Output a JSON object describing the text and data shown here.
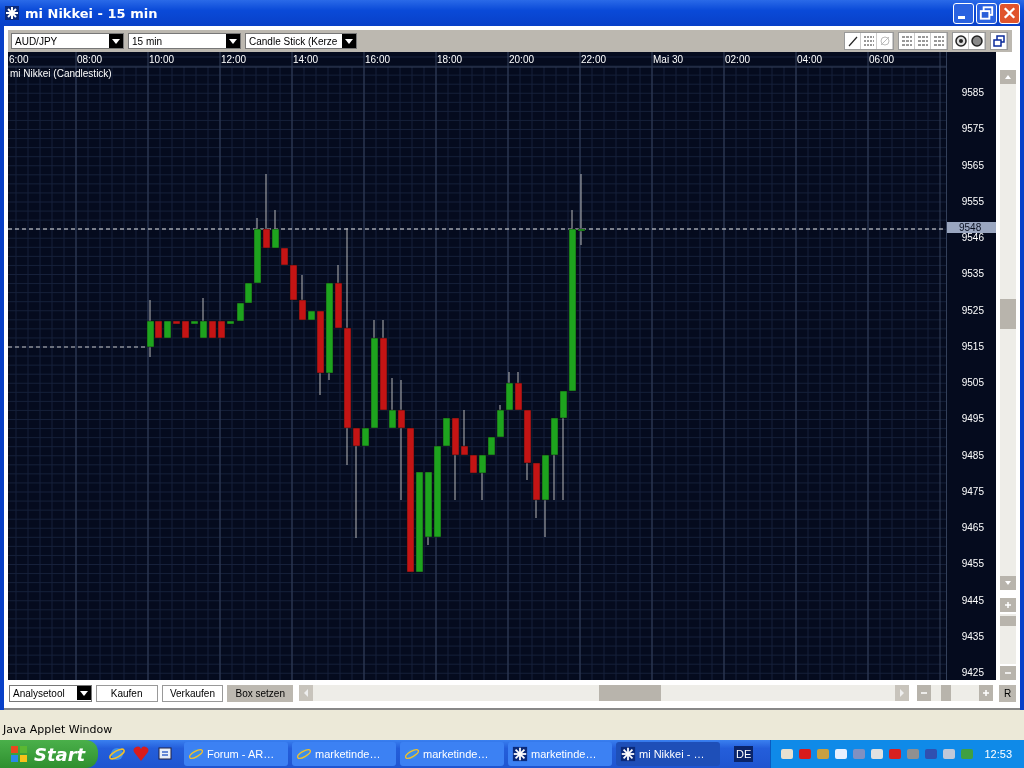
{
  "window": {
    "title": "mi Nikkei - 15 min"
  },
  "toolbar": {
    "dropdowns": [
      {
        "value": "AUD/JPY"
      },
      {
        "value": "15 min"
      },
      {
        "value": "Candle Stick (Kerze"
      }
    ]
  },
  "chart": {
    "title": "mi Nikkei (Candlestick)",
    "x_labels": [
      "6:00",
      "08:00",
      "10:00",
      "12:00",
      "14:00",
      "16:00",
      "18:00",
      "20:00",
      "22:00",
      "Mai 30",
      "02:00",
      "04:00",
      "06:00"
    ],
    "y_labels": [
      "9585",
      "9575",
      "9565",
      "9555",
      "9546",
      "9535",
      "9525",
      "9515",
      "9505",
      "9495",
      "9485",
      "9475",
      "9465",
      "9455",
      "9445",
      "9435",
      "9425"
    ],
    "current_price": "9548"
  },
  "bottom_bar": {
    "tool_dropdown": "Analysetool",
    "buttons": [
      {
        "label": "Kaufen",
        "selected": false
      },
      {
        "label": "Verkaufen",
        "selected": false
      },
      {
        "label": "Box setzen",
        "selected": true
      }
    ],
    "reset_button": "R",
    "time_zoom": {
      "level": 0.25
    }
  },
  "status_bar": "Java Applet Window",
  "taskbar": {
    "start": "Start",
    "tasks": [
      {
        "label": "Forum - AR…",
        "kind": "browser",
        "selected": false
      },
      {
        "label": "marketinde…",
        "kind": "browser",
        "selected": false
      },
      {
        "label": "marketinde…",
        "kind": "browser",
        "selected": false
      },
      {
        "label": "marketinde…",
        "kind": "applet",
        "selected": false
      },
      {
        "label": "mi Nikkei - …",
        "kind": "applet",
        "selected": true
      }
    ],
    "language": "DE",
    "clock": "12:53"
  }
}
